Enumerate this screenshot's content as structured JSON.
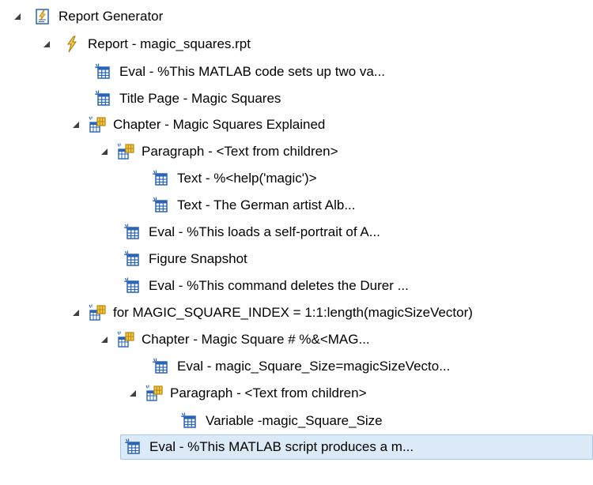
{
  "tree": {
    "root_label": "Report Generator",
    "report_label": "Report - magic_squares.rpt",
    "items": [
      {
        "label": "Eval - %This MATLAB code sets up two va..."
      },
      {
        "label": "Title Page - Magic Squares"
      },
      {
        "label": "Chapter - Magic Squares Explained"
      },
      {
        "label": "Paragraph - <Text from children>"
      },
      {
        "label": "Text - %<help('magic')>"
      },
      {
        "label": "Text - The German artist Alb..."
      },
      {
        "label": "Eval - %This loads a self-portrait of A..."
      },
      {
        "label": "Figure Snapshot"
      },
      {
        "label": "Eval - %This command deletes the Durer ..."
      },
      {
        "label": "for MAGIC_SQUARE_INDEX = 1:1:length(magicSizeVector)"
      },
      {
        "label": "Chapter - Magic Square # %&<MAG..."
      },
      {
        "label": "Eval - magic_Square_Size=magicSizeVecto..."
      },
      {
        "label": "Paragraph - <Text from children>"
      },
      {
        "label": "Variable -magic_Square_Size"
      },
      {
        "label": "Eval - %This MATLAB script produces a m..."
      }
    ]
  },
  "colors": {
    "selection_bg": "#dce9f7",
    "selection_border": "#a6c7ea",
    "icon_blue": "#2a63b8",
    "icon_gold": "#e0a800"
  },
  "icons": {
    "root": "report-generator-icon",
    "report": "lightning-icon",
    "component": "table-icon",
    "container": "table-group-icon"
  }
}
